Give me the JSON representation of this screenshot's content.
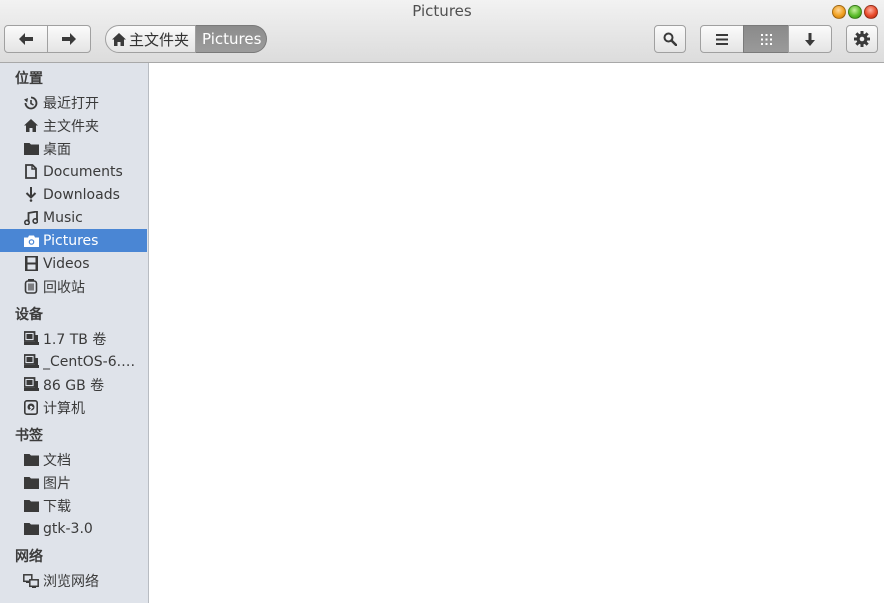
{
  "window": {
    "title": "Pictures"
  },
  "pathbar": {
    "home_label": "主文件夹",
    "current_label": "Pictures"
  },
  "sidebar": {
    "sections": {
      "places": "位置",
      "devices": "设备",
      "bookmarks": "书签",
      "network": "网络"
    },
    "places": [
      {
        "label": "最近打开",
        "icon": "recent-icon"
      },
      {
        "label": "主文件夹",
        "icon": "home-icon"
      },
      {
        "label": "桌面",
        "icon": "folder-icon"
      },
      {
        "label": "Documents",
        "icon": "document-icon"
      },
      {
        "label": "Downloads",
        "icon": "download-icon"
      },
      {
        "label": "Music",
        "icon": "music-icon"
      },
      {
        "label": "Pictures",
        "icon": "camera-icon",
        "selected": true
      },
      {
        "label": "Videos",
        "icon": "film-icon"
      },
      {
        "label": "回收站",
        "icon": "trash-icon"
      }
    ],
    "devices": [
      {
        "label": "1.7 TB 卷",
        "icon": "drive-icon"
      },
      {
        "label": "_CentOS-6.…",
        "icon": "drive-icon"
      },
      {
        "label": "86 GB 卷",
        "icon": "drive-icon"
      },
      {
        "label": "计算机",
        "icon": "harddisk-icon"
      }
    ],
    "bookmarks": [
      {
        "label": "文档",
        "icon": "folder-icon"
      },
      {
        "label": "图片",
        "icon": "folder-icon"
      },
      {
        "label": "下载",
        "icon": "folder-icon"
      },
      {
        "label": "gtk-3.0",
        "icon": "folder-icon"
      }
    ],
    "network": [
      {
        "label": "浏览网络",
        "icon": "network-icon"
      }
    ]
  },
  "colors": {
    "selection": "#4a86d4",
    "sidebar_bg": "#dfe3ea",
    "header_bg": "#e6e6e6"
  }
}
